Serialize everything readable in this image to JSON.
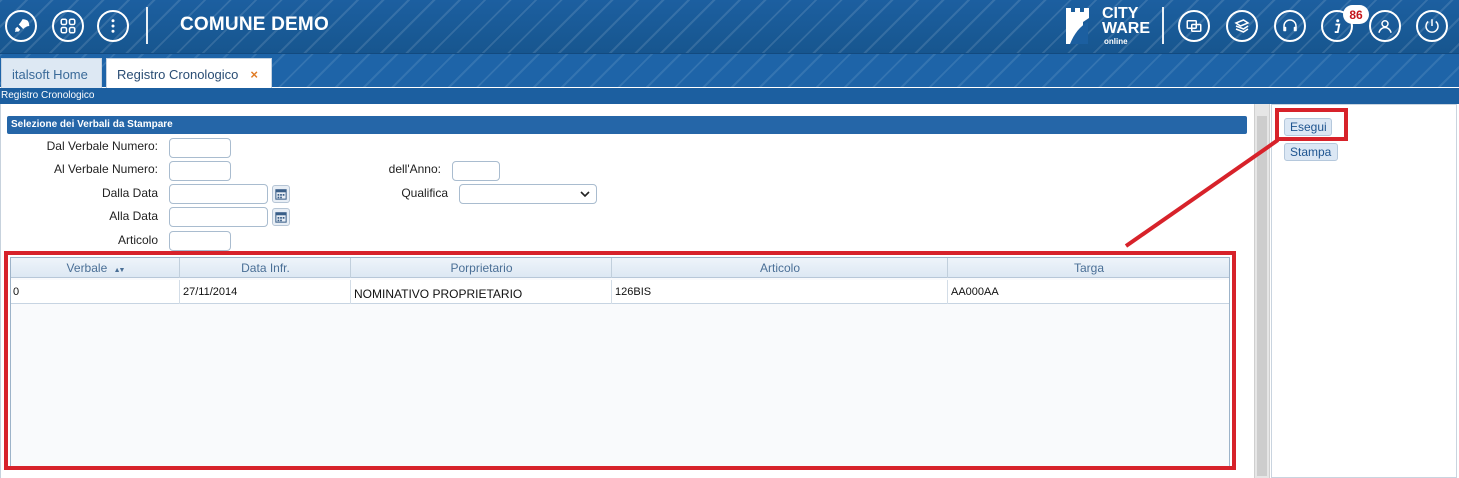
{
  "header": {
    "app_title": "COMUNE DEMO",
    "logo_line1": "CITY",
    "logo_line2": "WARE",
    "logo_line3": "online",
    "notification_count": "86",
    "left_icons": [
      "rocket-icon",
      "apps-grid-icon",
      "more-vertical-icon"
    ],
    "right_icons": [
      "windows-icon",
      "docs-icon",
      "headset-icon",
      "info-icon",
      "user-icon",
      "power-icon"
    ]
  },
  "tabs": [
    {
      "label": "italsoft Home"
    },
    {
      "label": "Registro Cronologico",
      "close": "×"
    }
  ],
  "breadcrumb": "Registro Cronologico",
  "form": {
    "section_title": "Selezione dei Verbali da Stampare",
    "dal_verbale_label": "Dal Verbale Numero:",
    "al_verbale_label": "Al Verbale Numero:",
    "anno_label": "dell'Anno:",
    "dalla_data_label": "Dalla Data",
    "alla_data_label": "Alla Data",
    "qualifica_label": "Qualifica",
    "articolo_label": "Articolo",
    "dal_verbale_value": "",
    "al_verbale_value": "",
    "anno_value": "",
    "dalla_data_value": "",
    "alla_data_value": "",
    "qualifica_value": "",
    "articolo_value": ""
  },
  "grid": {
    "columns": [
      "Verbale",
      "Data Infr.",
      "Porprietario",
      "Articolo",
      "Targa"
    ],
    "sort_indicator": "▲▼",
    "rows": [
      [
        "0",
        "27/11/2014",
        "NOMINATIVO PROPRIETARIO",
        "126BIS",
        "AA000AA"
      ]
    ]
  },
  "actions": {
    "esegui_label": "Esegui",
    "stampa_label": "Stampa"
  },
  "colors": {
    "header_blue": "#1c5fa0",
    "section_blue": "#2566a8",
    "annotation_red": "#d7222a",
    "tab_close_orange": "#e07b24"
  }
}
